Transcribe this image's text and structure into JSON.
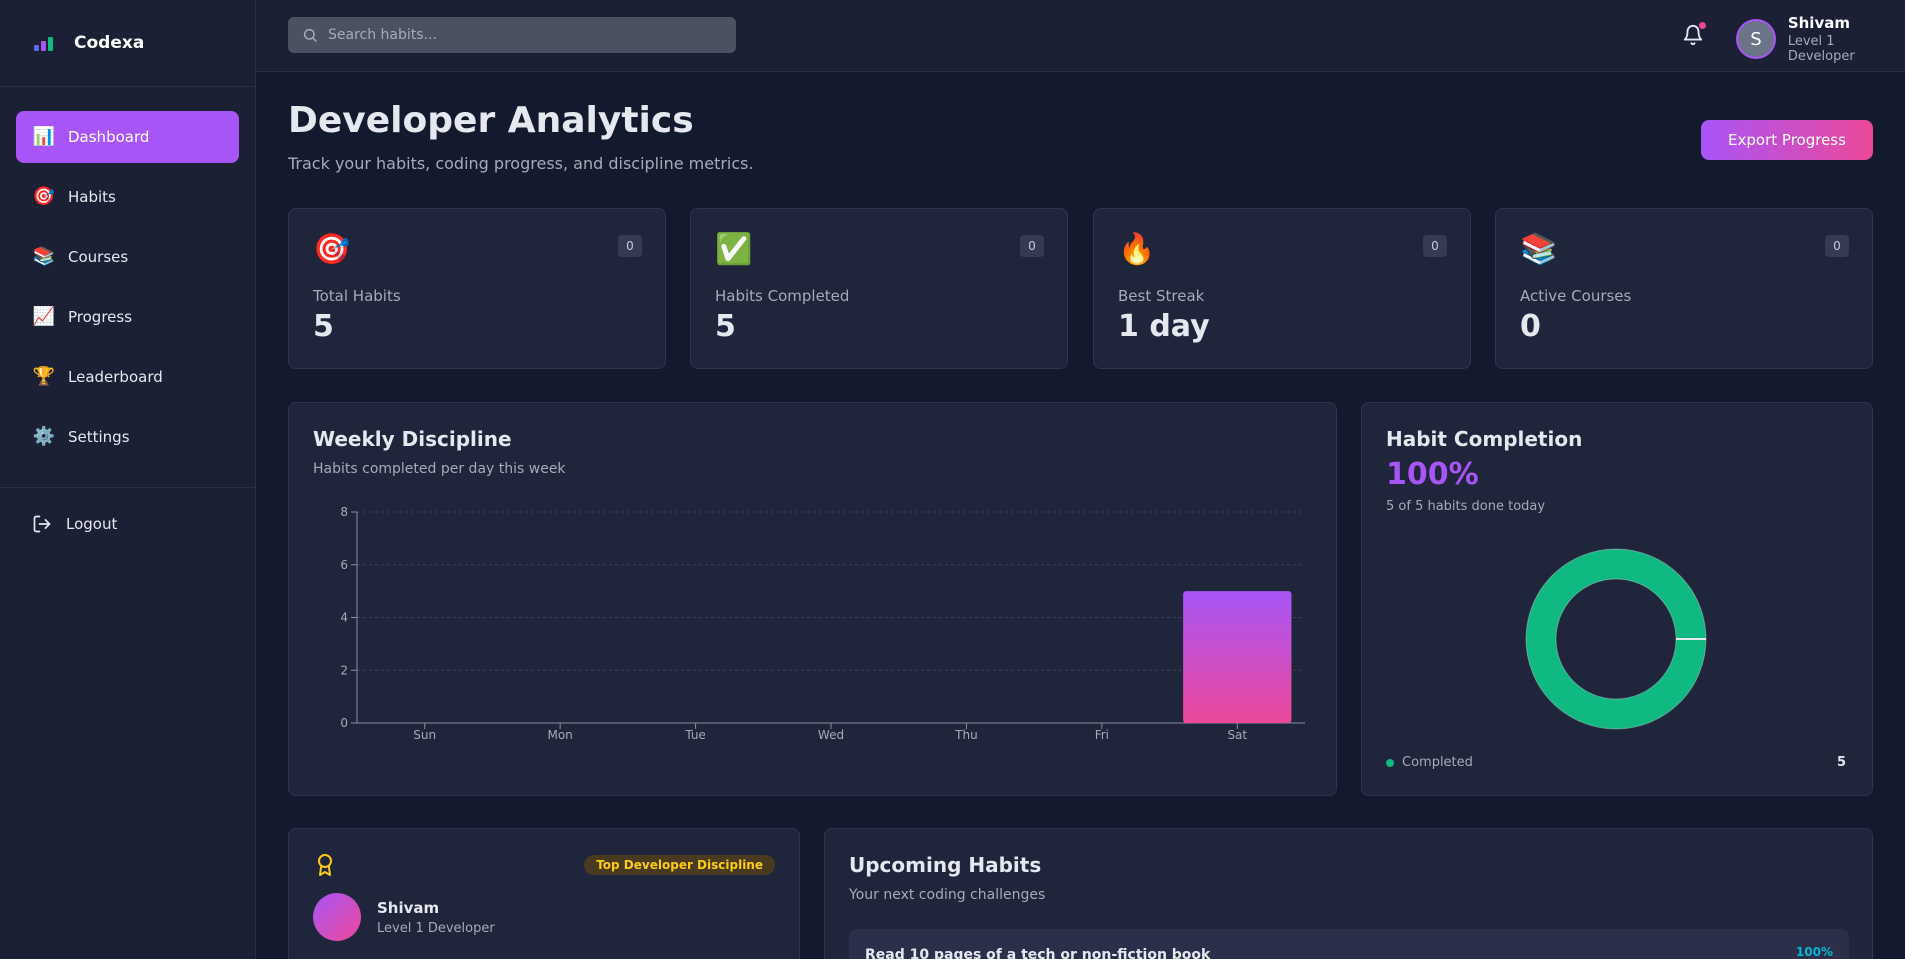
{
  "brand": {
    "name": "Codexa"
  },
  "sidebar": {
    "items": [
      {
        "label": "Dashboard",
        "icon": "📊",
        "active": true
      },
      {
        "label": "Habits",
        "icon": "🎯"
      },
      {
        "label": "Courses",
        "icon": "📚"
      },
      {
        "label": "Progress",
        "icon": "📈"
      },
      {
        "label": "Leaderboard",
        "icon": "🏆"
      },
      {
        "label": "Settings",
        "icon": "⚙️"
      }
    ],
    "logout_label": "Logout"
  },
  "topbar": {
    "search_placeholder": "Search habits...",
    "user_initial": "S",
    "user_name": "Shivam",
    "user_level": "Level 1 Developer"
  },
  "header": {
    "title": "Developer Analytics",
    "subtitle": "Track your habits, coding progress, and discipline metrics.",
    "export_label": "Export Progress"
  },
  "stats": [
    {
      "icon": "🎯",
      "badge": "0",
      "label": "Total Habits",
      "value": "5"
    },
    {
      "icon": "✅",
      "badge": "0",
      "label": "Habits Completed",
      "value": "5"
    },
    {
      "icon": "🔥",
      "badge": "0",
      "label": "Best Streak",
      "value": "1 day"
    },
    {
      "icon": "📚",
      "badge": "0",
      "label": "Active Courses",
      "value": "0"
    }
  ],
  "weekly": {
    "title": "Weekly Discipline",
    "subtitle": "Habits completed per day this week"
  },
  "chart_data": {
    "type": "bar",
    "categories": [
      "Sun",
      "Mon",
      "Tue",
      "Wed",
      "Thu",
      "Fri",
      "Sat"
    ],
    "values": [
      0,
      0,
      0,
      0,
      0,
      0,
      5
    ],
    "yticks": [
      "0",
      "2",
      "4",
      "6",
      "8"
    ],
    "ylim": [
      0,
      8
    ],
    "grid": true
  },
  "completion": {
    "title": "Habit Completion",
    "percent": "100%",
    "subtitle": "5 of 5 habits done today",
    "legend_label": "Completed",
    "legend_value": "5",
    "completed_fraction": 1.0,
    "color": "#10b981"
  },
  "profile": {
    "badge": "Top Developer Discipline",
    "name": "Shivam",
    "level": "Level 1 Developer"
  },
  "upcoming": {
    "title": "Upcoming Habits",
    "subtitle": "Your next coding challenges",
    "items": [
      {
        "name": "Read 10 pages of a tech or non-fiction book",
        "percent": "100%"
      }
    ]
  }
}
